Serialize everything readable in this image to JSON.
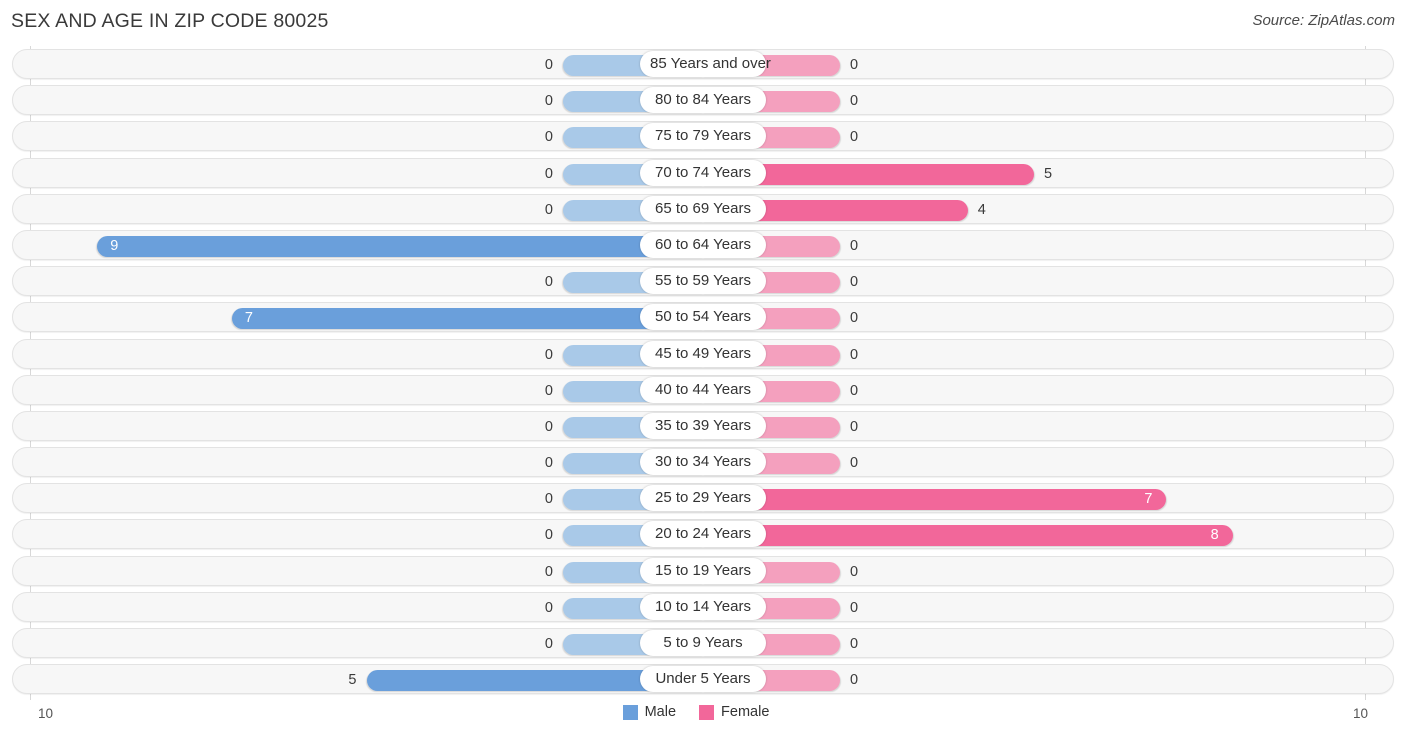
{
  "header": {
    "title": "SEX AND AGE IN ZIP CODE 80025",
    "source": "Source: ZipAtlas.com"
  },
  "legend": {
    "items": [
      {
        "label": "Male",
        "color": "#6A9FDB"
      },
      {
        "label": "Female",
        "color": "#F2679A"
      }
    ]
  },
  "axis": {
    "left_max": "10",
    "right_max": "10"
  },
  "colors": {
    "male_active": "#6A9FDB",
    "male_zero": "#A9C9E8",
    "female_active": "#F2679A",
    "female_zero": "#F4A0BE",
    "track_bg": "#F7F7F7",
    "track_border": "#E3E3E3",
    "gridline": "#D8D8D8"
  },
  "chart_data": {
    "type": "bar",
    "subtype": "population-pyramid",
    "title": "SEX AND AGE IN ZIP CODE 80025",
    "xlabel": "",
    "ylabel": "",
    "xlim": [
      10,
      10
    ],
    "axis_max": 10,
    "grid": true,
    "legend_position": "bottom-center",
    "categories": [
      "85 Years and over",
      "80 to 84 Years",
      "75 to 79 Years",
      "70 to 74 Years",
      "65 to 69 Years",
      "60 to 64 Years",
      "55 to 59 Years",
      "50 to 54 Years",
      "45 to 49 Years",
      "40 to 44 Years",
      "35 to 39 Years",
      "30 to 34 Years",
      "25 to 29 Years",
      "20 to 24 Years",
      "15 to 19 Years",
      "10 to 14 Years",
      "5 to 9 Years",
      "Under 5 Years"
    ],
    "series": [
      {
        "name": "Male",
        "color": "#6A9FDB",
        "values": [
          0,
          0,
          0,
          0,
          0,
          9,
          0,
          7,
          0,
          0,
          0,
          0,
          0,
          0,
          0,
          0,
          0,
          5
        ]
      },
      {
        "name": "Female",
        "color": "#F2679A",
        "values": [
          0,
          0,
          0,
          0,
          0,
          0,
          0,
          0,
          0,
          0,
          0,
          0,
          7,
          8,
          0,
          0,
          0,
          0
        ]
      }
    ]
  },
  "rows": [
    {
      "age": "85 Years and over",
      "male": "0",
      "female": "0"
    },
    {
      "age": "80 to 84 Years",
      "male": "0",
      "female": "0"
    },
    {
      "age": "75 to 79 Years",
      "male": "0",
      "female": "0"
    },
    {
      "age": "70 to 74 Years",
      "male": "0",
      "female": "5"
    },
    {
      "age": "65 to 69 Years",
      "male": "0",
      "female": "4"
    },
    {
      "age": "60 to 64 Years",
      "male": "9",
      "female": "0"
    },
    {
      "age": "55 to 59 Years",
      "male": "0",
      "female": "0"
    },
    {
      "age": "50 to 54 Years",
      "male": "7",
      "female": "0"
    },
    {
      "age": "45 to 49 Years",
      "male": "0",
      "female": "0"
    },
    {
      "age": "40 to 44 Years",
      "male": "0",
      "female": "0"
    },
    {
      "age": "35 to 39 Years",
      "male": "0",
      "female": "0"
    },
    {
      "age": "30 to 34 Years",
      "male": "0",
      "female": "0"
    },
    {
      "age": "25 to 29 Years",
      "male": "0",
      "female": "7"
    },
    {
      "age": "20 to 24 Years",
      "male": "0",
      "female": "8"
    },
    {
      "age": "15 to 19 Years",
      "male": "0",
      "female": "0"
    },
    {
      "age": "10 to 14 Years",
      "male": "0",
      "female": "0"
    },
    {
      "age": "5 to 9 Years",
      "male": "0",
      "female": "0"
    },
    {
      "age": "Under 5 Years",
      "male": "5",
      "female": "0"
    }
  ]
}
